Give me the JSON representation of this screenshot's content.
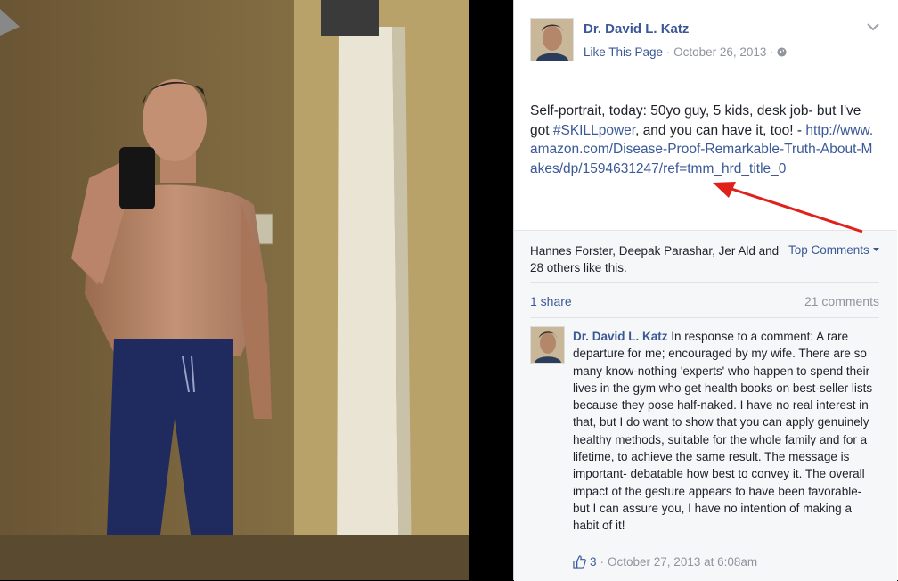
{
  "post": {
    "page_name": "Dr. David L. Katz",
    "like_page_label": "Like This Page",
    "separator": " · ",
    "date": "October 26, 2013",
    "text_before_hashtag": "Self-portrait, today: 50yo guy, 5 kids, desk job- but I've got ",
    "hashtag": "#SKILLpower",
    "text_after_hashtag": ", and you can have it, too! - ",
    "link": "http://www.amazon.com/Disease-Proof-Remarkable-Truth-About-Makes/dp/1594631247/ref=tmm_hrd_title_0"
  },
  "engagement": {
    "likes_text": "Hannes Forster, Deepak Parashar, Jer Ald and 28 others like this.",
    "top_comments_label": "Top Comments",
    "shares_label": "1 share",
    "comments_label": "21 comments"
  },
  "comment": {
    "author": "Dr. David L. Katz",
    "text": " In response to a comment: A rare departure for me; encouraged by my wife. There are so many know-nothing 'experts' who happen to spend their lives in the gym who get health books on best-seller lists because they pose half-naked. I have no real interest in that, but I do want to show that you can apply genuinely healthy methods, suitable for the whole family and for a lifetime, to achieve the same result. The message is important- debatable how best to convey it. The overall impact of the gesture appears to have been favorable- but I can assure you, I have no intention of making a habit of it!",
    "like_count": "3",
    "separator": " · ",
    "timestamp": "October 27, 2013 at 6:08am"
  },
  "icons": {
    "globe": "globe-icon",
    "chevron": "chevron-down-icon",
    "thumbs_up": "thumbs-up-icon",
    "annotation_arrow": "red-arrow"
  },
  "colors": {
    "link_blue": "#3b5998",
    "meta_gray": "#90949c",
    "arrow_red": "#e0211b"
  }
}
